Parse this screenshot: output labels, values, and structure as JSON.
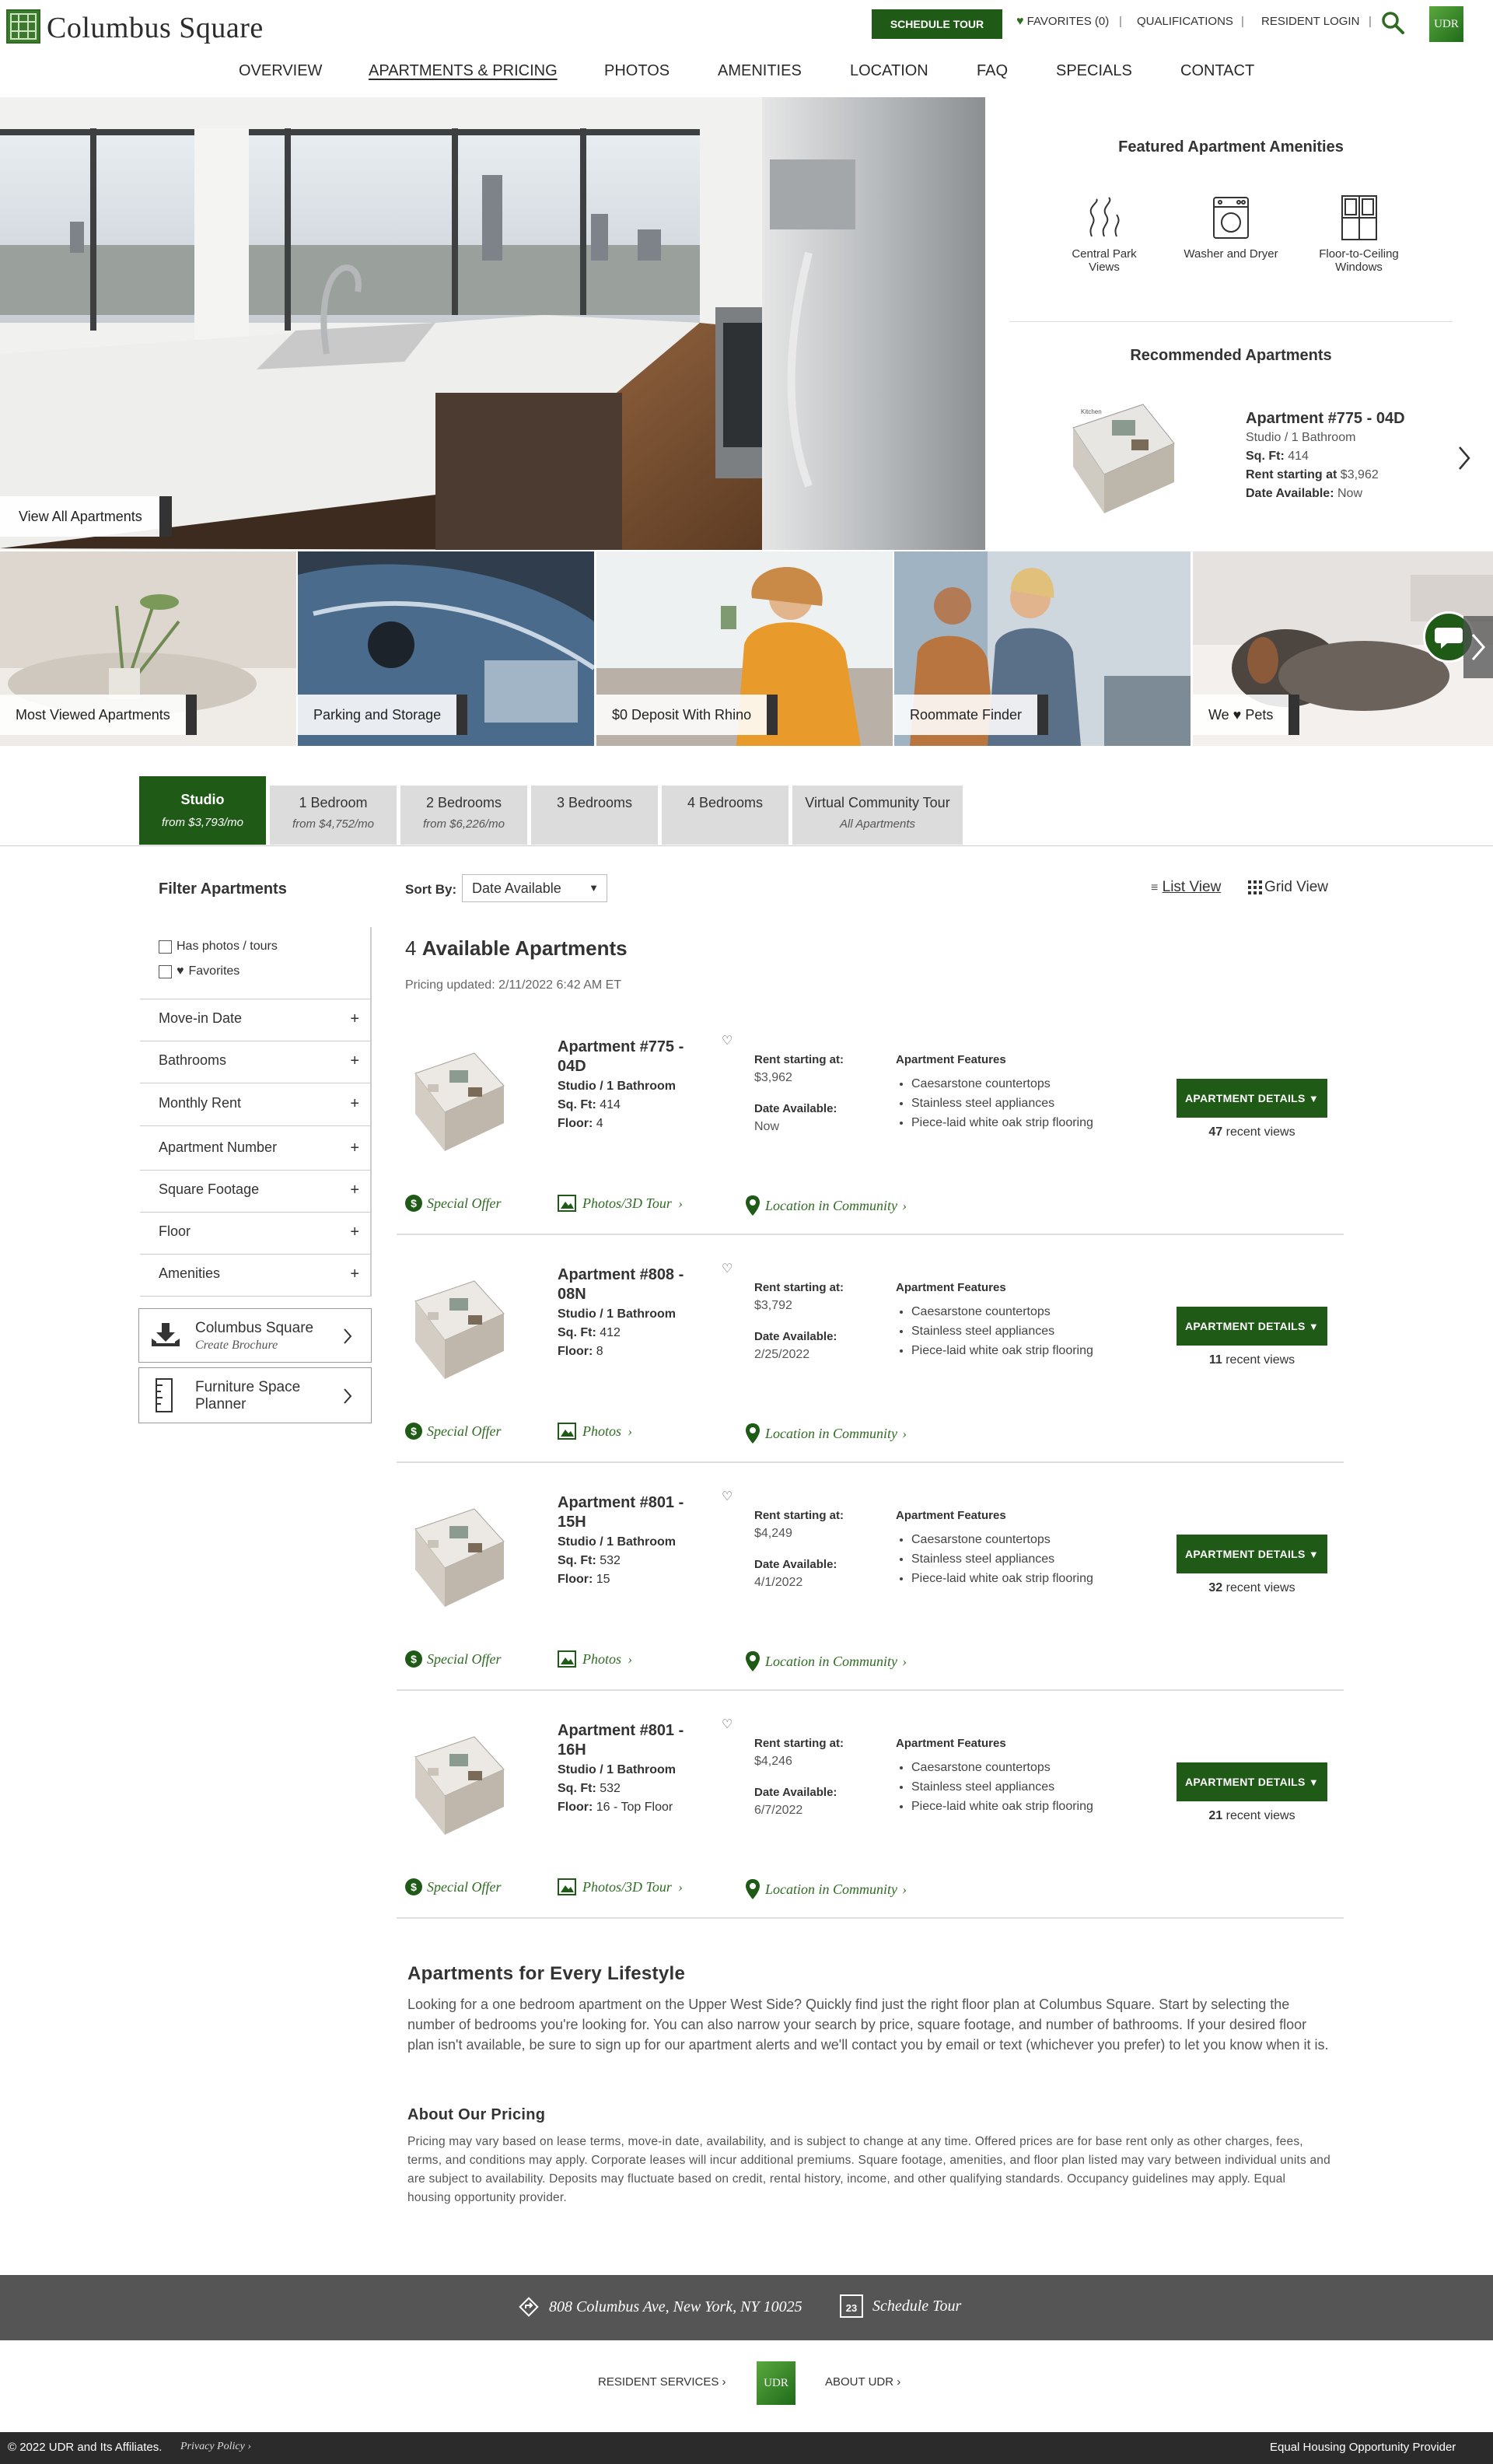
{
  "header": {
    "brand": "Columbus Square",
    "schedule_tour": "SCHEDULE TOUR",
    "favorites": "FAVORITES (0)",
    "qualifications": "QUALIFICATIONS",
    "resident_login": "RESIDENT LOGIN",
    "udr_logo": "UDR",
    "nav": [
      "OVERVIEW",
      "APARTMENTS & PRICING",
      "PHOTOS",
      "AMENITIES",
      "LOCATION",
      "FAQ",
      "SPECIALS",
      "CONTACT"
    ]
  },
  "hero": {
    "view_all": "View All Apartments"
  },
  "featured": {
    "title": "Featured Apartment Amenities",
    "amenities": [
      {
        "label_1": "Central Park",
        "label_2": "Views",
        "icon": "trees-icon"
      },
      {
        "label_1": "Washer and Dryer",
        "label_2": "",
        "icon": "washer-icon"
      },
      {
        "label_1": "Floor-to-Ceiling",
        "label_2": "Windows",
        "icon": "window-icon"
      }
    ],
    "recommended_title": "Recommended Apartments",
    "rec": {
      "name": "Apartment #775 - 04D",
      "type": "Studio / 1 Bathroom",
      "sqft_label": "Sq. Ft:",
      "sqft": "414",
      "rent_label": "Rent starting at",
      "rent": "$3,962",
      "avail_label": "Date Available:",
      "avail": "Now"
    }
  },
  "tiles": [
    "Most Viewed Apartments",
    "Parking and Storage",
    "$0 Deposit With Rhino",
    "Roommate Finder",
    "We ♥ Pets"
  ],
  "tabs": [
    {
      "label": "Studio",
      "sub": "from $3,793/mo"
    },
    {
      "label": "1 Bedroom",
      "sub": "from $4,752/mo"
    },
    {
      "label": "2 Bedrooms",
      "sub": "from $6,226/mo"
    },
    {
      "label": "3 Bedrooms",
      "sub": ""
    },
    {
      "label": "4 Bedrooms",
      "sub": ""
    },
    {
      "label": "Virtual Community Tour",
      "sub": "All Apartments"
    }
  ],
  "filters": {
    "title": "Filter Apartments",
    "has_photos": "Has photos / tours",
    "favorites": "Favorites",
    "items": [
      "Move-in Date",
      "Bathrooms",
      "Monthly Rent",
      "Apartment Number",
      "Square Footage",
      "Floor",
      "Amenities"
    ],
    "brochure_title": "Columbus Square",
    "brochure_sub": "Create Brochure",
    "planner_1": "Furniture Space",
    "planner_2": "Planner"
  },
  "listing": {
    "sort_label": "Sort By:",
    "sort_value": "Date Available",
    "list_view": "List View",
    "grid_view": "Grid View",
    "count_num": "4",
    "count_text": "Available Apartments",
    "pricing_updated": "Pricing updated: 2/11/2022 6:42 AM ET",
    "rent_label": "Rent starting at:",
    "avail_label": "Date Available:",
    "features_label": "Apartment Features",
    "details_label": "APARTMENT DETAILS",
    "views_suffix": "recent views",
    "special_offer": "Special Offer",
    "location": "Location in Community",
    "apartments": [
      {
        "name_1": "Apartment #775 -",
        "name_2": "04D",
        "type": "Studio / 1 Bathroom",
        "sqft": "414",
        "floor": "4",
        "rent": "$3,962",
        "avail": "Now",
        "views": "47",
        "media": "Photos/3D Tour",
        "features": [
          "Caesarstone countertops",
          "Stainless steel appliances",
          "Piece-laid white oak strip flooring"
        ]
      },
      {
        "name_1": "Apartment #808 -",
        "name_2": "08N",
        "type": "Studio / 1 Bathroom",
        "sqft": "412",
        "floor": "8",
        "rent": "$3,792",
        "avail": "2/25/2022",
        "views": "11",
        "media": "Photos",
        "features": [
          "Caesarstone countertops",
          "Stainless steel appliances",
          "Piece-laid white oak strip flooring"
        ]
      },
      {
        "name_1": "Apartment #801 -",
        "name_2": "15H",
        "type": "Studio / 1 Bathroom",
        "sqft": "532",
        "floor": "15",
        "rent": "$4,249",
        "avail": "4/1/2022",
        "views": "32",
        "media": "Photos",
        "features": [
          "Caesarstone countertops",
          "Stainless steel appliances",
          "Piece-laid white oak strip flooring"
        ]
      },
      {
        "name_1": "Apartment #801 -",
        "name_2": "16H",
        "type": "Studio / 1 Bathroom",
        "sqft": "532",
        "floor": "16 - Top Floor",
        "rent": "$4,246",
        "avail": "6/7/2022",
        "views": "21",
        "media": "Photos/3D Tour",
        "features": [
          "Caesarstone countertops",
          "Stainless steel appliances",
          "Piece-laid white oak strip flooring"
        ]
      }
    ],
    "sqft_label": "Sq. Ft:",
    "floor_label": "Floor:"
  },
  "content": {
    "lifestyle_title": "Apartments for Every Lifestyle",
    "lifestyle_text": "Looking for a one bedroom apartment on the Upper West Side? Quickly find just the right floor plan at Columbus Square. Start by selecting the number of bedrooms you're looking for. You can also narrow your search by price, square footage, and number of bathrooms. If your desired floor plan isn't available, be sure to sign up for our apartment alerts and we'll contact you by email or text (whichever you prefer) to let you know when it is.",
    "pricing_title": "About Our Pricing",
    "pricing_text": "Pricing may vary based on lease terms, move-in date, availability, and is subject to change at any time. Offered prices are for base rent only as other charges, fees, terms, and conditions may apply. Corporate leases will incur additional premiums. Square footage, amenities, and floor plan listed may vary between individual units and are subject to availability. Deposits may fluctuate based on credit, rental history, income, and other qualifying standards. Occupancy guidelines may apply. Equal housing opportunity provider."
  },
  "footer": {
    "address": "808 Columbus Ave, New York, NY 10025",
    "schedule": "Schedule Tour",
    "calendar_day": "23",
    "resident_services": "RESIDENT SERVICES",
    "about_udr": "ABOUT UDR",
    "copyright": "© 2022 UDR and Its Affiliates.",
    "privacy": "Privacy Policy",
    "equal_housing": "Equal Housing Opportunity Provider"
  },
  "colors": {
    "brand_green": "#1f5b17",
    "link_green": "#2f6b23",
    "footer_gray": "#555555"
  }
}
